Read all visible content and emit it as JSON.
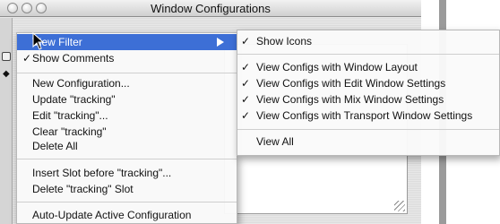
{
  "window": {
    "title": "Window Configurations"
  },
  "main_menu": {
    "items": [
      {
        "label": "View Filter",
        "check": ""
      },
      {
        "label": "Show Comments",
        "check": "✓"
      },
      {
        "label": "New Configuration...",
        "check": ""
      },
      {
        "label": "Update \"tracking\"",
        "check": ""
      },
      {
        "label": "Edit \"tracking\"...",
        "check": ""
      },
      {
        "label": "Clear \"tracking\"",
        "check": ""
      },
      {
        "label": "Delete All",
        "check": ""
      },
      {
        "label": "Insert Slot before \"tracking\"...",
        "check": ""
      },
      {
        "label": "Delete \"tracking\" Slot",
        "check": ""
      },
      {
        "label": "Auto-Update Active Configuration",
        "check": ""
      }
    ]
  },
  "submenu": {
    "items": [
      {
        "label": "Show Icons",
        "check": "✓"
      },
      {
        "label": "View Configs with Window Layout",
        "check": "✓"
      },
      {
        "label": "View Configs with Edit Window Settings",
        "check": "✓"
      },
      {
        "label": "View Configs with Mix Window Settings",
        "check": "✓"
      },
      {
        "label": "View Configs with Transport Window Settings",
        "check": "✓"
      },
      {
        "label": "View All",
        "check": ""
      }
    ]
  },
  "colors": {
    "selection": "#3d6fd6",
    "menu_bg": "#fafafa"
  },
  "icons": {
    "background_row_marker": "diamond-icon"
  }
}
